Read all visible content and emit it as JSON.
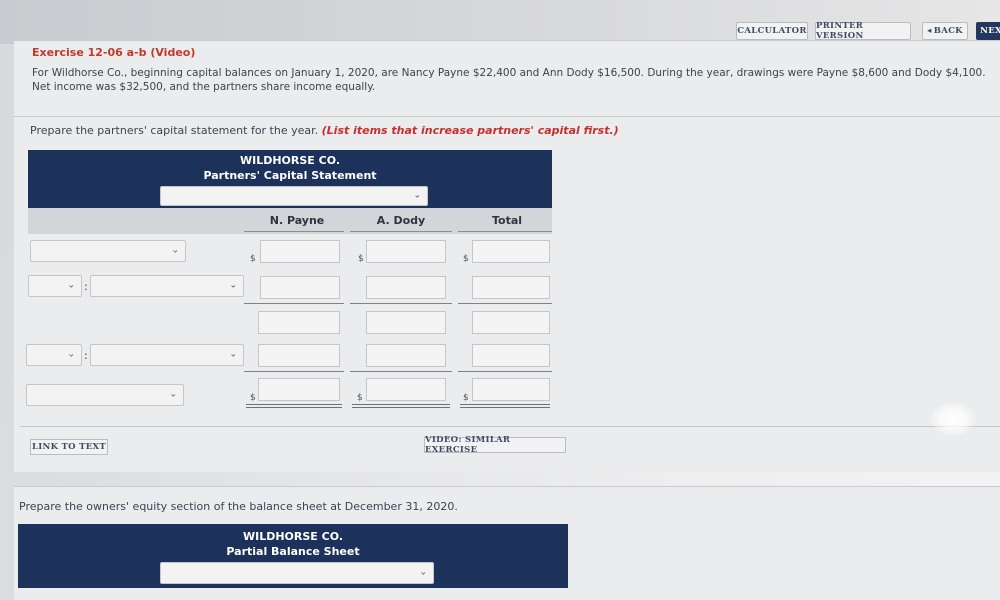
{
  "toolbar": {
    "calculator": "CALCULATOR",
    "printer_version": "PRINTER VERSION",
    "back": "BACK",
    "back_icon": "◂",
    "next": "NEX"
  },
  "exercise": {
    "title": "Exercise 12-06 a-b (Video)",
    "description": "For Wildhorse Co., beginning capital balances on January 1, 2020, are Nancy Payne $22,400 and Ann Dody $16,500. During the year, drawings were Payne $8,600 and Dody $4,100. Net income was $32,500, and the partners share income equally."
  },
  "part_a": {
    "instruction": "Prepare the partners' capital statement for the year.",
    "instruction_emphasis": "(List items that increase partners' capital first.)",
    "company": "WILDHORSE CO.",
    "statement_title": "Partners' Capital Statement",
    "period_select_value": "",
    "columns": [
      "N. Payne",
      "A. Dody",
      "Total"
    ],
    "currency_symbol": "$",
    "rows": [
      {
        "label": "",
        "values": [
          "",
          "",
          ""
        ]
      },
      {
        "prefix": "",
        "label": "",
        "values": [
          "",
          "",
          ""
        ]
      },
      {
        "values": [
          "",
          "",
          ""
        ]
      },
      {
        "prefix": "",
        "label": "",
        "values": [
          "",
          "",
          ""
        ]
      },
      {
        "label": "",
        "values": [
          "",
          "",
          ""
        ]
      }
    ],
    "link_to_text": "LINK TO TEXT",
    "video_similar": "VIDEO: SIMILAR EXERCISE"
  },
  "part_b": {
    "instruction": "Prepare the owners' equity section of the balance sheet at December 31, 2020.",
    "company": "WILDHORSE CO.",
    "statement_title": "Partial Balance Sheet",
    "date_select_value": ""
  }
}
